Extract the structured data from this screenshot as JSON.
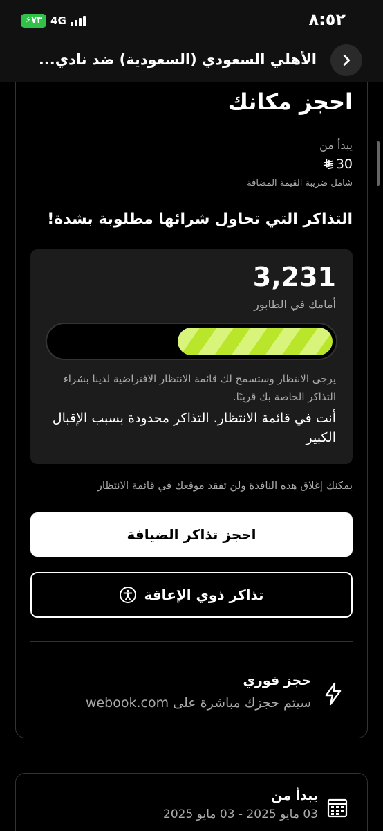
{
  "status_bar": {
    "time": "٨:٥٢",
    "battery": "٧٣",
    "network": "4G"
  },
  "header": {
    "title": "الأهلي السعودي (السعودية) ضد نادي..."
  },
  "booking": {
    "title": "احجز مكانك",
    "starts_from": "يبدأ من",
    "price": "30",
    "vat_note": "شامل ضريبة القيمة المضافة",
    "demand_heading": "التذاكر التي تحاول شرائها مطلوبة بشدة!"
  },
  "queue": {
    "count": "3,231",
    "ahead_label": "أمامك في الطابور",
    "progress_fraction": 0.55,
    "description": "يرجى الانتظار وستسمح لك قائمة الانتظار الافتراضية لدينا بشراء التذاكر الخاصة بك قريبًا.",
    "status": "أنت في قائمة الانتظار. التذاكر محدودة بسبب الإقبال الكبير"
  },
  "close_note": "يمكنك إغلاق هذه النافذة ولن تفقد موقعك في قائمة الانتظار",
  "buttons": {
    "hospitality": "احجز تذاكر الضيافة",
    "accessibility": "تذاكر ذوي الإعاقة"
  },
  "instant": {
    "title": "حجز فوري",
    "subtitle": "سيتم حجزك مباشرة على webook.com"
  },
  "dates": {
    "label": "يبدأ من",
    "range": "03 مايو 2025 - 03 مايو 2025"
  },
  "colors": {
    "progress_light": "#d9f47a",
    "progress_dark": "#b9e62a",
    "battery": "#31c048"
  }
}
